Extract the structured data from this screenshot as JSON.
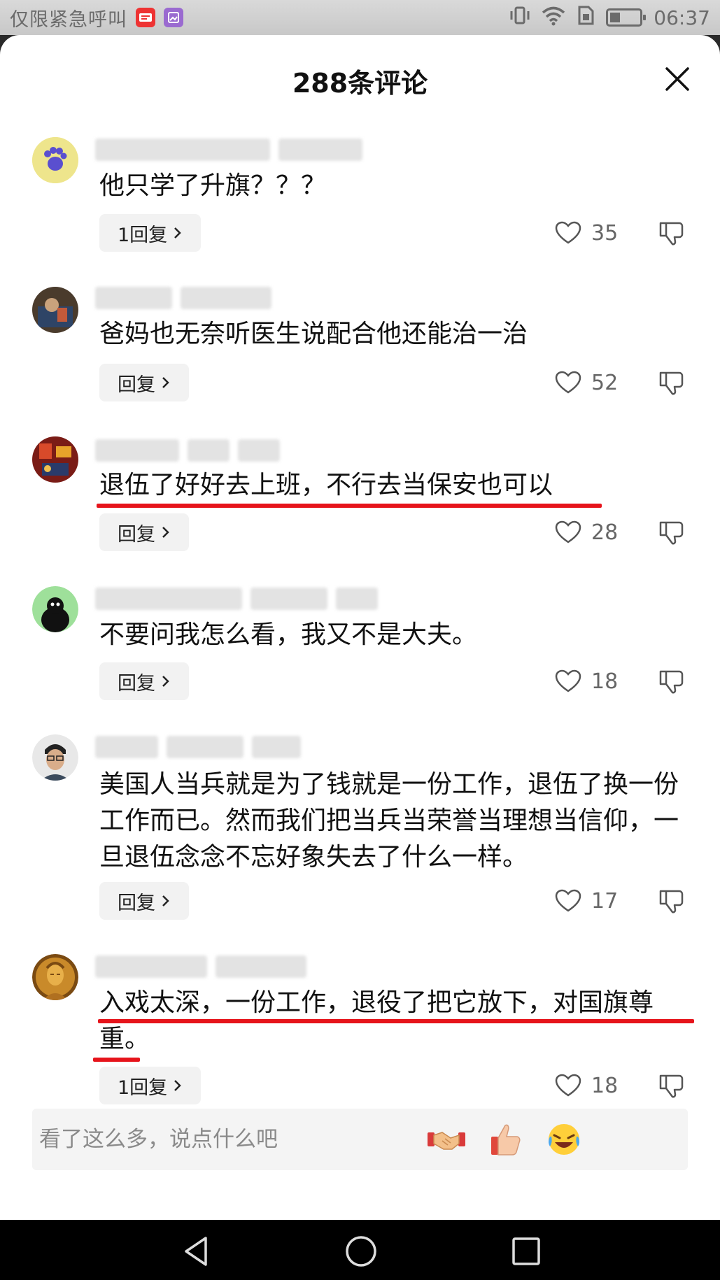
{
  "status_bar": {
    "carrier": "仅限紧急呼叫",
    "time": "06:37"
  },
  "header": {
    "title": "288条评论"
  },
  "comments": [
    {
      "text": "他只学了升旗？？？",
      "reply_label": "1回复",
      "likes": "35"
    },
    {
      "text": "爸妈也无奈听医生说配合他还能治一治",
      "reply_label": "回复",
      "likes": "52"
    },
    {
      "text": "退伍了好好去上班，不行去当保安也可以",
      "reply_label": "回复",
      "likes": "28"
    },
    {
      "text": "不要问我怎么看，我又不是大夫。",
      "reply_label": "回复",
      "likes": "18"
    },
    {
      "text": "美国人当兵就是为了钱就是一份工作，退伍了换一份工作而已。然而我们把当兵当荣誉当理想当信仰，一旦退伍念念不忘好象失去了什么一样。",
      "reply_label": "回复",
      "likes": "17"
    },
    {
      "text": "入戏太深，一份工作，退役了把它放下，对国旗尊重。",
      "reply_label": "1回复",
      "likes": "18"
    }
  ],
  "input": {
    "placeholder": "看了这么多，说点什么吧"
  },
  "colors": {
    "accent_underline": "#e6141b",
    "sheet_bg": "#ffffff",
    "reply_bg": "#f2f2f2"
  }
}
